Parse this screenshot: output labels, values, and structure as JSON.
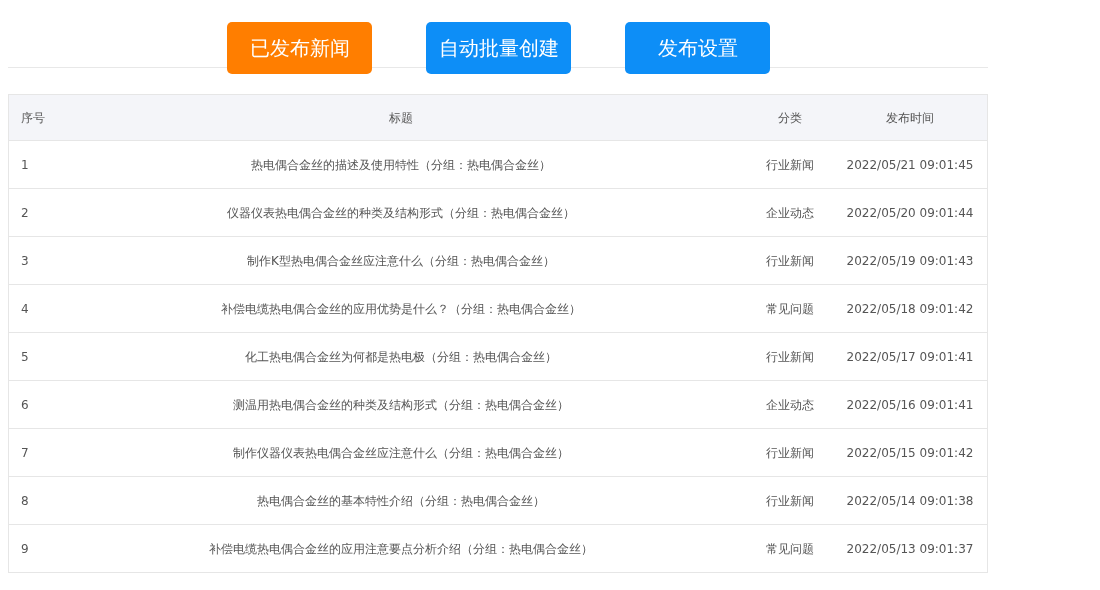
{
  "buttons": [
    {
      "label": "已发布新闻",
      "selected": true
    },
    {
      "label": "自动批量创建",
      "selected": false
    },
    {
      "label": "发布设置",
      "selected": false
    }
  ],
  "table": {
    "columns": [
      "序号",
      "标题",
      "分类",
      "发布时间"
    ],
    "rows": [
      [
        "1",
        "热电偶合金丝的描述及使用特性（分组：热电偶合金丝）",
        "行业新闻",
        "2022/05/21 09:01:45"
      ],
      [
        "2",
        "仪器仪表热电偶合金丝的种类及结构形式（分组：热电偶合金丝）",
        "企业动态",
        "2022/05/20 09:01:44"
      ],
      [
        "3",
        "制作K型热电偶合金丝应注意什么（分组：热电偶合金丝）",
        "行业新闻",
        "2022/05/19 09:01:43"
      ],
      [
        "4",
        "补偿电缆热电偶合金丝的应用优势是什么？（分组：热电偶合金丝）",
        "常见问题",
        "2022/05/18 09:01:42"
      ],
      [
        "5",
        "化工热电偶合金丝为何都是热电极（分组：热电偶合金丝）",
        "行业新闻",
        "2022/05/17 09:01:41"
      ],
      [
        "6",
        "测温用热电偶合金丝的种类及结构形式（分组：热电偶合金丝）",
        "企业动态",
        "2022/05/16 09:01:41"
      ],
      [
        "7",
        "制作仪器仪表热电偶合金丝应注意什么（分组：热电偶合金丝）",
        "行业新闻",
        "2022/05/15 09:01:42"
      ],
      [
        "8",
        "热电偶合金丝的基本特性介绍（分组：热电偶合金丝）",
        "行业新闻",
        "2022/05/14 09:01:38"
      ],
      [
        "9",
        "补偿电缆热电偶合金丝的应用注意要点分析介绍（分组：热电偶合金丝）",
        "常见问题",
        "2022/05/13 09:01:37"
      ]
    ]
  }
}
